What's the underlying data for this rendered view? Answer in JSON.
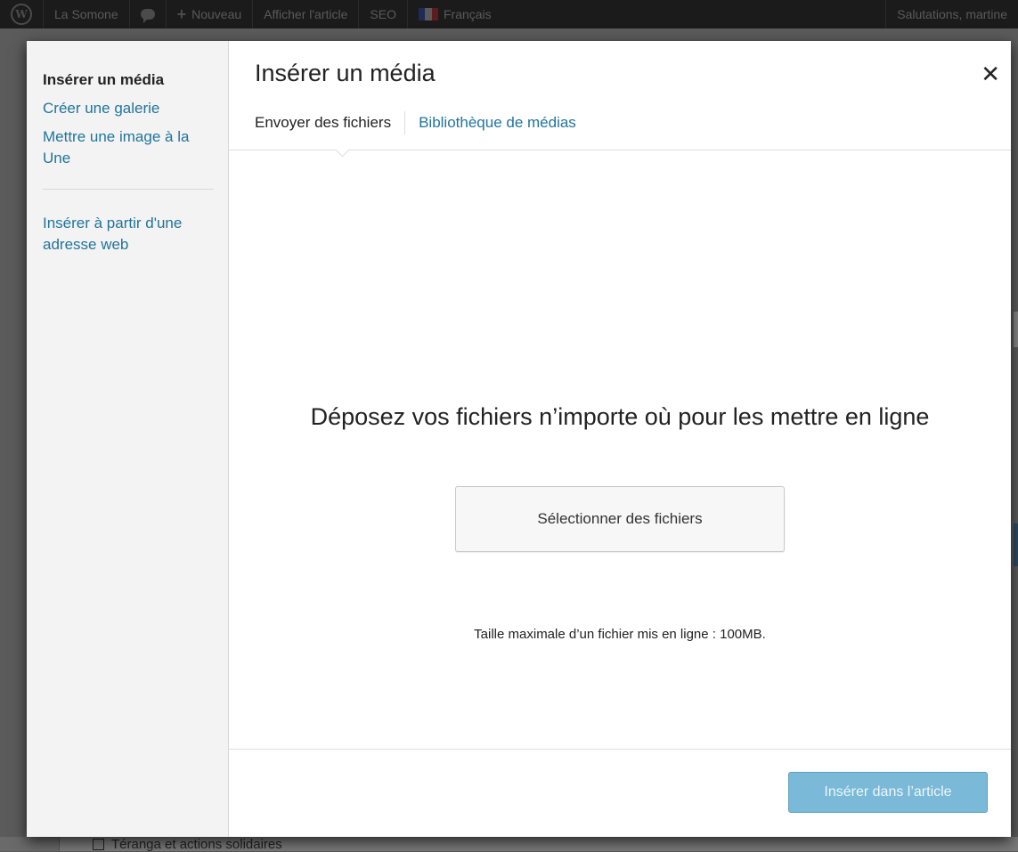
{
  "admin_bar": {
    "site_name": "La Somone",
    "new_label": "Nouveau",
    "view_post_label": "Afficher l'article",
    "seo_label": "SEO",
    "language_label": "Français",
    "greeting": "Salutations, martine"
  },
  "background": {
    "category_label": "Téranga et actions solidaires"
  },
  "media_menu": {
    "items": [
      {
        "label": "Insérer un média"
      },
      {
        "label": "Créer une galerie"
      },
      {
        "label": "Mettre une image à la Une"
      },
      {
        "label": "Insérer à partir d'une adresse web"
      }
    ]
  },
  "modal": {
    "title": "Insérer un média",
    "close_icon": "close-icon",
    "tabs": [
      {
        "label": "Envoyer des fichiers"
      },
      {
        "label": "Bibliothèque de médias"
      }
    ],
    "upload": {
      "instructions": "Déposez vos fichiers n’importe où pour les mettre en ligne",
      "select_button": "Sélectionner des fichiers",
      "max_size": "Taille maximale d’un fichier mis en ligne : 100MB."
    },
    "insert_button": "Insérer dans l’article"
  },
  "colors": {
    "link": "#21759b",
    "primary_button_disabled": "#7ab9d7"
  }
}
